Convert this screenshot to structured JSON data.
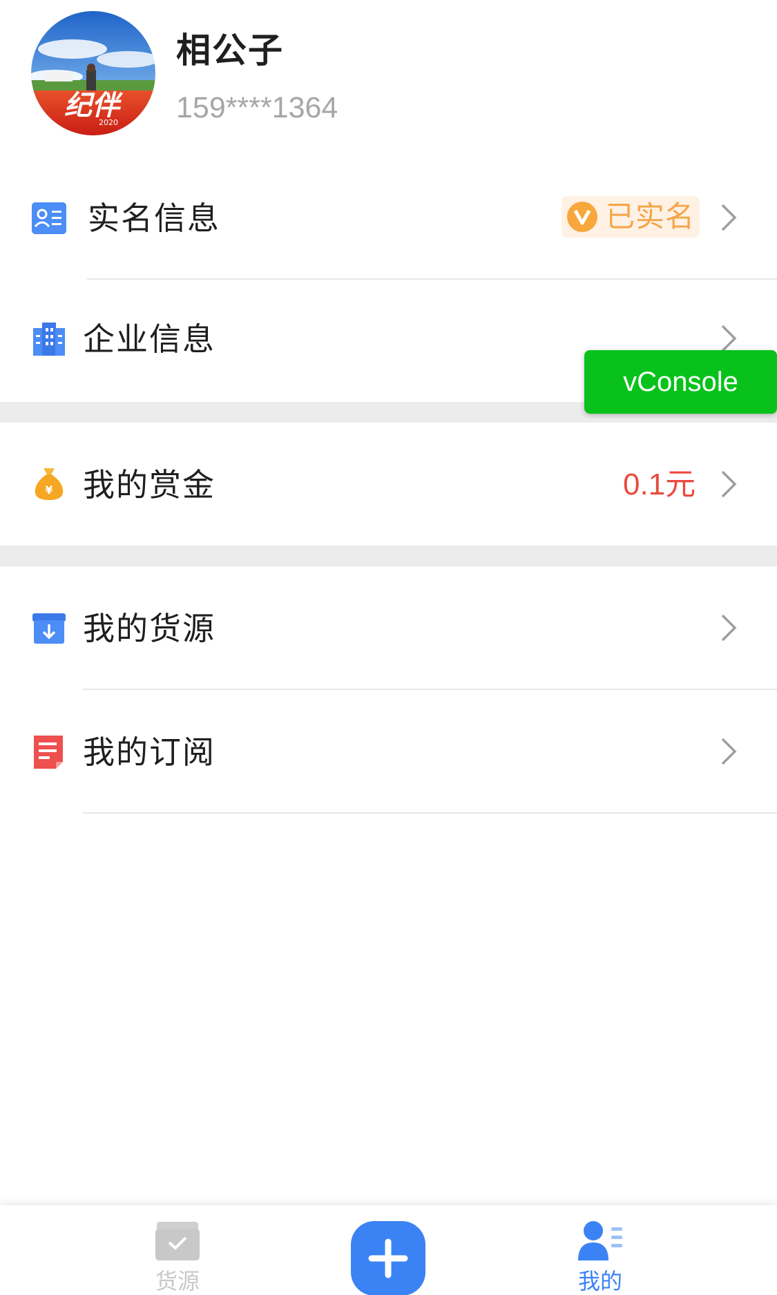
{
  "profile": {
    "name": "相公子",
    "phone": "159****1364"
  },
  "menu": {
    "realname": {
      "label": "实名信息",
      "badge": "已实名"
    },
    "company": {
      "label": "企业信息"
    },
    "bounty": {
      "label": "我的赏金",
      "value": "0.1元"
    },
    "cargo": {
      "label": "我的货源"
    },
    "subscription": {
      "label": "我的订阅"
    }
  },
  "vconsole": {
    "label": "vConsole"
  },
  "tabbar": {
    "cargo": {
      "label": "货源",
      "icon": "cargo-box-icon"
    },
    "publish": {
      "icon": "plus-icon"
    },
    "mine": {
      "label": "我的",
      "icon": "user-profile-icon"
    }
  },
  "colors": {
    "accent_blue": "#3b83f5",
    "bounty_red": "#e94a3e",
    "verified_orange": "#f4a64a",
    "vconsole_green": "#08c21b",
    "inactive_gray": "#c8c8c8"
  }
}
